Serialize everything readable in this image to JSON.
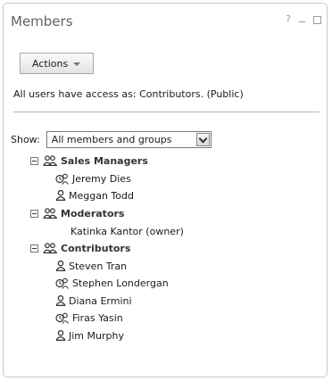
{
  "panel": {
    "title": "Members",
    "controls": {
      "help": "?",
      "minimize": "",
      "maximize": ""
    }
  },
  "actions": {
    "label": "Actions"
  },
  "access_text": "All users have access as: Contributors. (Public)",
  "show": {
    "label": "Show:",
    "selected": "All members and groups"
  },
  "groups": [
    {
      "name": "Sales Managers",
      "members": [
        {
          "name": "Jeremy Dies",
          "icon": "online-user-icon"
        },
        {
          "name": "Meggan Todd",
          "icon": "user-icon"
        }
      ]
    },
    {
      "name": "Moderators",
      "members": [
        {
          "name": "Katinka Kantor (owner)",
          "icon": ""
        }
      ]
    },
    {
      "name": "Contributors",
      "members": [
        {
          "name": "Steven Tran",
          "icon": "user-icon"
        },
        {
          "name": "Stephen Londergan",
          "icon": "online-user-icon"
        },
        {
          "name": "Diana Ermini",
          "icon": "user-icon"
        },
        {
          "name": "Firas Yasin",
          "icon": "online-user-icon"
        },
        {
          "name": "Jim Murphy",
          "icon": "user-icon"
        }
      ]
    }
  ]
}
